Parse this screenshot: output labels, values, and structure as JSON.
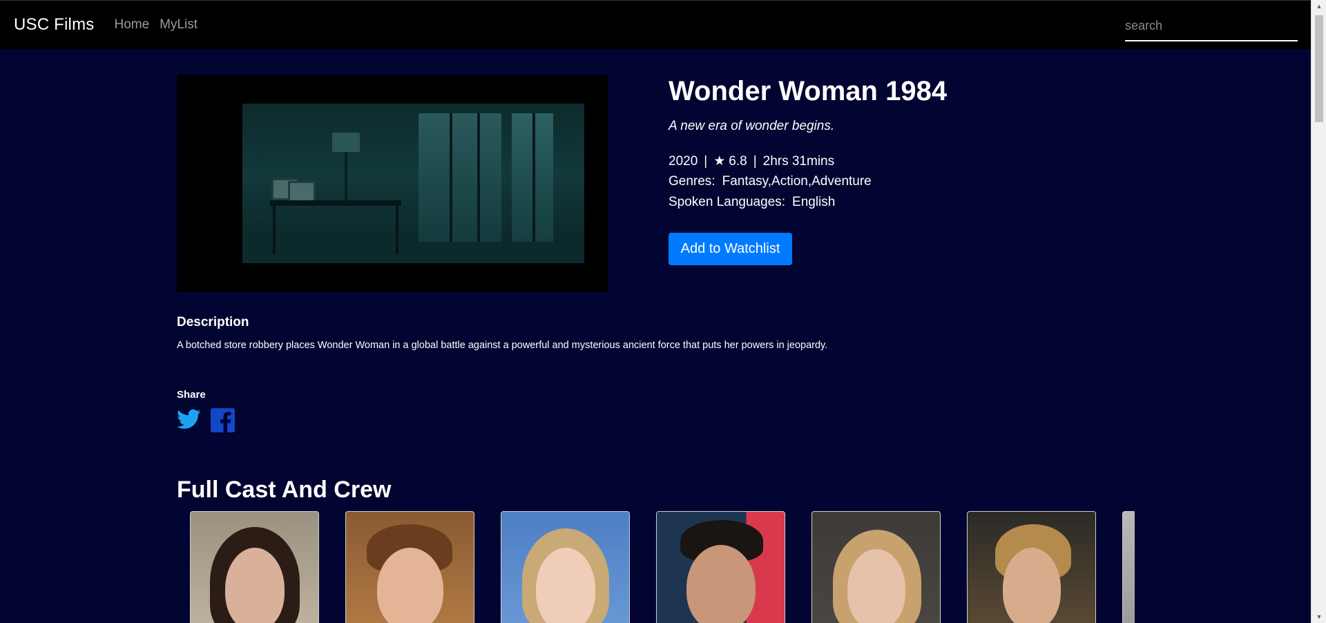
{
  "navbar": {
    "brand": "USC Films",
    "links": [
      "Home",
      "MyList"
    ],
    "search_placeholder": "search"
  },
  "movie": {
    "title": "Wonder Woman 1984",
    "tagline": "A new era of wonder begins.",
    "year": "2020",
    "separator": "|",
    "star_symbol": "★",
    "rating": "6.8",
    "runtime": "2hrs 31mins",
    "genres_label": "Genres:",
    "genres": "Fantasy,Action,Adventure",
    "languages_label": "Spoken Languages:",
    "languages": "English",
    "watchlist_button": "Add to Watchlist"
  },
  "description": {
    "heading": "Description",
    "text": "A botched store robbery places Wonder Woman in a global battle against a powerful and mysterious ancient force that puts her powers in jeopardy."
  },
  "share": {
    "heading": "Share",
    "icons": [
      "twitter-icon",
      "facebook-icon"
    ]
  },
  "cast": {
    "heading": "Full Cast And Crew",
    "card_count_visible": 7
  },
  "colors": {
    "page_background": "#020431",
    "navbar_background": "#000000",
    "button_primary": "#007bff",
    "twitter_blue": "#1da1f2",
    "facebook_blue": "#1446c8"
  }
}
